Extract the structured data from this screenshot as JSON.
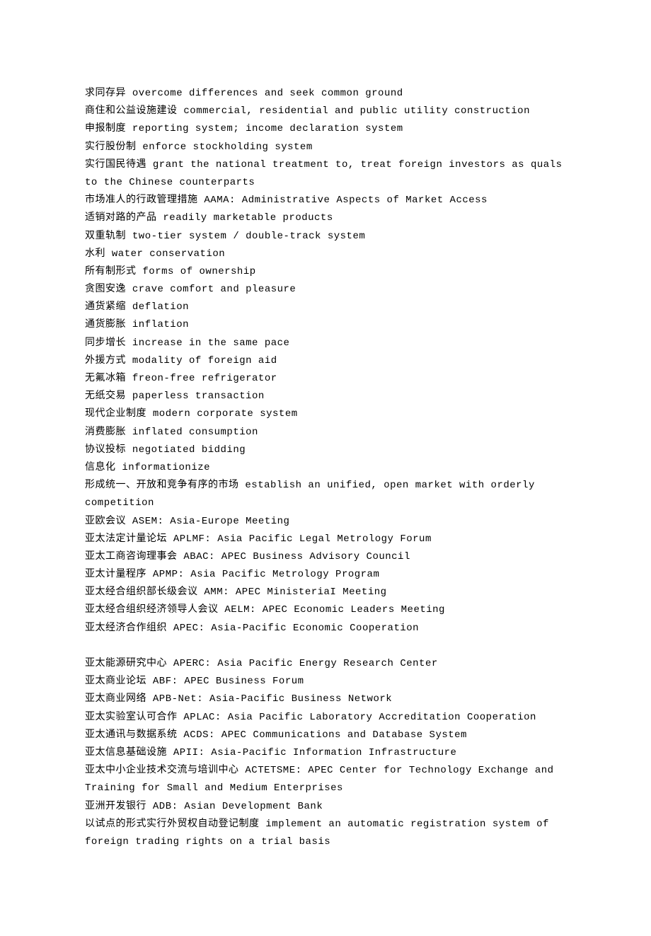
{
  "entries_block1": [
    "求同存异 overcome differences and seek common ground",
    "商住和公益设施建设 commercial, residential and public utility construction",
    "申报制度 reporting system; income declaration system",
    "实行股份制 enforce stockholding system",
    "实行国民待遇 grant the national treatment to, treat foreign investors as quals to the Chinese counterparts",
    "市场准人的行政管理措施 AAMA:  Administrative Aspects of Market Access",
    "适销对路的产品   readily marketable products",
    "双重轨制   two-tier system / double-track system",
    "水利 water conservation",
    "所有制形式 forms of ownership",
    "贪图安逸   crave comfort and pleasure",
    "通货紧缩 deflation",
    "通货膨胀 inflation",
    "同步增长 increase in the same pace",
    "外援方式   modality of foreign aid",
    "无氟冰箱   freon-free refrigerator",
    "无纸交易   paperless transaction",
    "现代企业制度 modern corporate system",
    "消费膨胀   inflated consumption",
    "协议投标 negotiated bidding",
    "信息化   informationize",
    "形成统一、开放和竞争有序的市场 establish an unified, open market with orderly competition",
    "亚欧会议 ASEM: Asia-Europe Meeting",
    "亚太法定计量论坛 APLMF: Asia Pacific Legal Metrology Forum",
    "亚太工商咨询理事会 ABAC:  APEC Business Advisory Council",
    "亚太计量程序 APMP: Asia Pacific Metrology Program",
    "亚太经合组织部长级会议 AMM: APEC MinisteriaI Meeting",
    "亚太经合组织经济领导人会议 AELM:  APEC Economic Leaders Meeting",
    "亚太经济合作组织 APEC: Asia-Pacific Economic Cooperation"
  ],
  "entries_block2": [
    "亚太能源研究中心 APERC: Asia Pacific Energy Research Center",
    "亚太商业论坛 ABF: APEC Business Forum",
    "亚太商业网络 APB-Net: Asia-Pacific Business Network",
    "亚太实验室认可合作 APLAC: Asia Pacific Laboratory Accreditation Cooperation",
    "亚太通讯与数据系统 ACDS: APEC Communications and Database System",
    "亚太信息基础设施 APII: Asia-Pacific Information Infrastructure",
    "亚太中小企业技术交流与培训中心 ACTETSME: APEC Center for Technology Exchange and Training for Small and Medium Enterprises",
    "亚洲开发银行 ADB: Asian Development Bank",
    "以试点的形式实行外贸权自动登记制度 implement an automatic registration system of foreign trading rights on a trial basis"
  ]
}
